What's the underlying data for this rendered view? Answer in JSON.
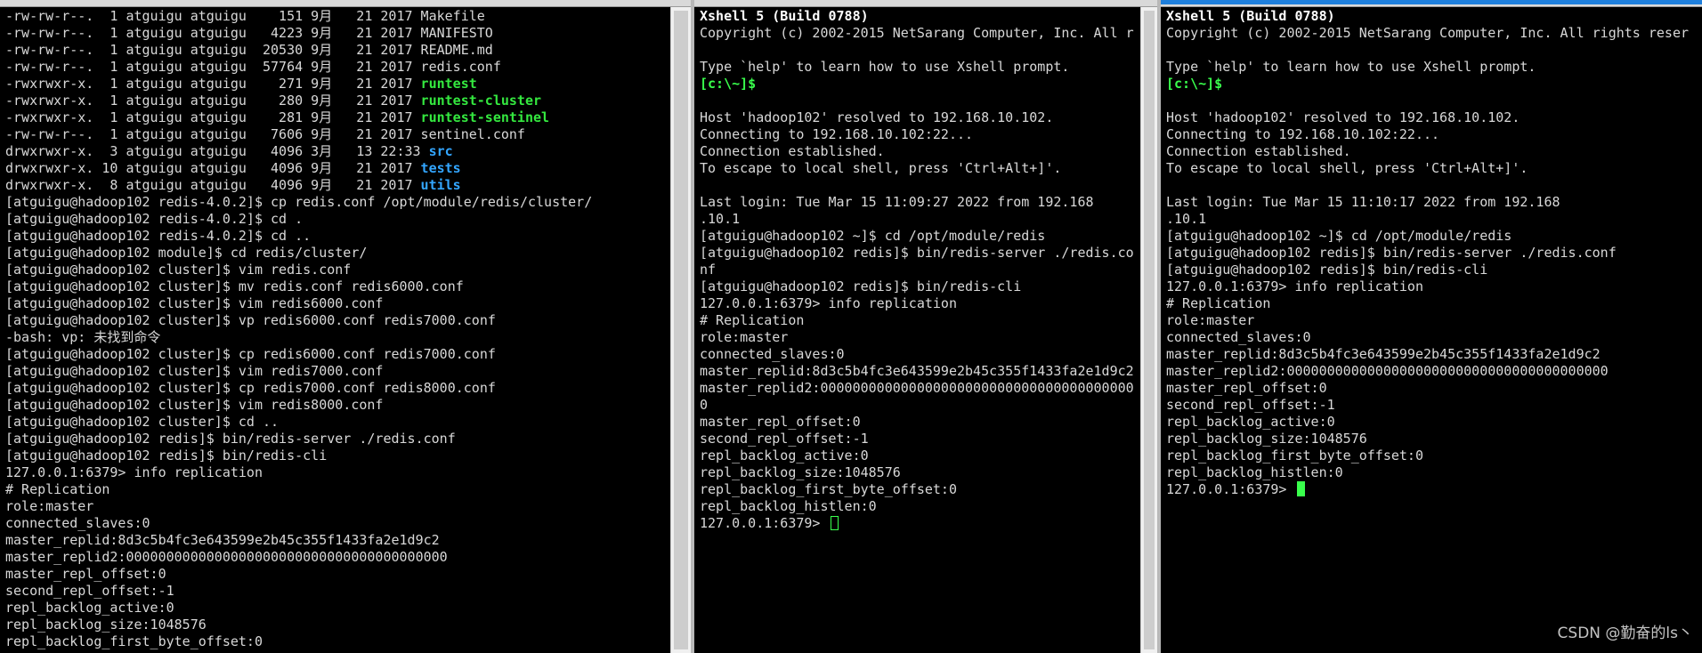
{
  "pane1": {
    "lines": [
      {
        "t": "-rw-rw-r--.  1 atguigu atguigu    151 9月   21 2017 Makefile"
      },
      {
        "t": "-rw-rw-r--.  1 atguigu atguigu   4223 9月   21 2017 MANIFESTO"
      },
      {
        "t": "-rw-rw-r--.  1 atguigu atguigu  20530 9月   21 2017 README.md"
      },
      {
        "t": "-rw-rw-r--.  1 atguigu atguigu  57764 9月   21 2017 redis.conf"
      },
      {
        "t": "-rwxrwxr-x.  1 atguigu atguigu    271 9月   21 2017 ",
        "hl": "runtest",
        "c": "exec"
      },
      {
        "t": "-rwxrwxr-x.  1 atguigu atguigu    280 9月   21 2017 ",
        "hl": "runtest-cluster",
        "c": "exec"
      },
      {
        "t": "-rwxrwxr-x.  1 atguigu atguigu    281 9月   21 2017 ",
        "hl": "runtest-sentinel",
        "c": "exec"
      },
      {
        "t": "-rw-rw-r--.  1 atguigu atguigu   7606 9月   21 2017 sentinel.conf"
      },
      {
        "t": "drwxrwxr-x.  3 atguigu atguigu   4096 3月   13 22:33 ",
        "hl": "src",
        "c": "dir"
      },
      {
        "t": "drwxrwxr-x. 10 atguigu atguigu   4096 9月   21 2017 ",
        "hl": "tests",
        "c": "dir"
      },
      {
        "t": "drwxrwxr-x.  8 atguigu atguigu   4096 9月   21 2017 ",
        "hl": "utils",
        "c": "dir"
      },
      {
        "t": "[atguigu@hadoop102 redis-4.0.2]$ cp redis.conf /opt/module/redis/cluster/"
      },
      {
        "t": "[atguigu@hadoop102 redis-4.0.2]$ cd ."
      },
      {
        "t": "[atguigu@hadoop102 redis-4.0.2]$ cd .."
      },
      {
        "t": "[atguigu@hadoop102 module]$ cd redis/cluster/"
      },
      {
        "t": "[atguigu@hadoop102 cluster]$ vim redis.conf"
      },
      {
        "t": "[atguigu@hadoop102 cluster]$ mv redis.conf redis6000.conf"
      },
      {
        "t": "[atguigu@hadoop102 cluster]$ vim redis6000.conf"
      },
      {
        "t": "[atguigu@hadoop102 cluster]$ vp redis6000.conf redis7000.conf"
      },
      {
        "t": "-bash: vp: 未找到命令"
      },
      {
        "t": "[atguigu@hadoop102 cluster]$ cp redis6000.conf redis7000.conf"
      },
      {
        "t": "[atguigu@hadoop102 cluster]$ vim redis7000.conf"
      },
      {
        "t": "[atguigu@hadoop102 cluster]$ cp redis7000.conf redis8000.conf"
      },
      {
        "t": "[atguigu@hadoop102 cluster]$ vim redis8000.conf"
      },
      {
        "t": "[atguigu@hadoop102 cluster]$ cd .."
      },
      {
        "t": "[atguigu@hadoop102 redis]$ bin/redis-server ./redis.conf"
      },
      {
        "t": "[atguigu@hadoop102 redis]$ bin/redis-cli"
      },
      {
        "t": "127.0.0.1:6379> info replication"
      },
      {
        "t": "# Replication"
      },
      {
        "t": "role:master"
      },
      {
        "t": "connected_slaves:0"
      },
      {
        "t": "master_replid:8d3c5b4fc3e643599e2b45c355f1433fa2e1d9c2"
      },
      {
        "t": "master_replid2:0000000000000000000000000000000000000000"
      },
      {
        "t": "master_repl_offset:0"
      },
      {
        "t": "second_repl_offset:-1"
      },
      {
        "t": "repl_backlog_active:0"
      },
      {
        "t": "repl_backlog_size:1048576"
      },
      {
        "t": "repl_backlog_first_byte_offset:0"
      }
    ]
  },
  "pane2": {
    "lines": [
      {
        "t": "Xshell 5 (Build 0788)",
        "c": "hdr"
      },
      {
        "t": "Copyright (c) 2002-2015 NetSarang Computer, Inc. All r"
      },
      {
        "t": ""
      },
      {
        "t": "Type `help' to learn how to use Xshell prompt."
      },
      {
        "t": "",
        "hl": "[c:\\~]$",
        "c": "prompt-green"
      },
      {
        "t": ""
      },
      {
        "t": "Host 'hadoop102' resolved to 192.168.10.102."
      },
      {
        "t": "Connecting to 192.168.10.102:22..."
      },
      {
        "t": "Connection established."
      },
      {
        "t": "To escape to local shell, press 'Ctrl+Alt+]'."
      },
      {
        "t": ""
      },
      {
        "t": "Last login: Tue Mar 15 11:09:27 2022 from 192.168"
      },
      {
        "t": ".10.1"
      },
      {
        "t": "[atguigu@hadoop102 ~]$ cd /opt/module/redis"
      },
      {
        "t": "[atguigu@hadoop102 redis]$ bin/redis-server ./redis.co"
      },
      {
        "t": "nf"
      },
      {
        "t": "[atguigu@hadoop102 redis]$ bin/redis-cli"
      },
      {
        "t": "127.0.0.1:6379> info replication"
      },
      {
        "t": "# Replication"
      },
      {
        "t": "role:master"
      },
      {
        "t": "connected_slaves:0"
      },
      {
        "t": "master_replid:8d3c5b4fc3e643599e2b45c355f1433fa2e1d9c2"
      },
      {
        "t": "master_replid2:000000000000000000000000000000000000000"
      },
      {
        "t": "0"
      },
      {
        "t": "master_repl_offset:0"
      },
      {
        "t": "second_repl_offset:-1"
      },
      {
        "t": "repl_backlog_active:0"
      },
      {
        "t": "repl_backlog_size:1048576"
      },
      {
        "t": "repl_backlog_first_byte_offset:0"
      },
      {
        "t": "repl_backlog_histlen:0"
      },
      {
        "t": "127.0.0.1:6379> ",
        "cursor": "box"
      }
    ]
  },
  "pane3": {
    "lines": [
      {
        "t": "Xshell 5 (Build 0788)",
        "c": "hdr"
      },
      {
        "t": "Copyright (c) 2002-2015 NetSarang Computer, Inc. All rights reser"
      },
      {
        "t": ""
      },
      {
        "t": "Type `help' to learn how to use Xshell prompt."
      },
      {
        "t": "",
        "hl": "[c:\\~]$",
        "c": "prompt-green"
      },
      {
        "t": ""
      },
      {
        "t": "Host 'hadoop102' resolved to 192.168.10.102."
      },
      {
        "t": "Connecting to 192.168.10.102:22..."
      },
      {
        "t": "Connection established."
      },
      {
        "t": "To escape to local shell, press 'Ctrl+Alt+]'."
      },
      {
        "t": ""
      },
      {
        "t": "Last login: Tue Mar 15 11:10:17 2022 from 192.168"
      },
      {
        "t": ".10.1"
      },
      {
        "t": "[atguigu@hadoop102 ~]$ cd /opt/module/redis"
      },
      {
        "t": "[atguigu@hadoop102 redis]$ bin/redis-server ./redis.conf"
      },
      {
        "t": "[atguigu@hadoop102 redis]$ bin/redis-cli"
      },
      {
        "t": "127.0.0.1:6379> info replication"
      },
      {
        "t": "# Replication"
      },
      {
        "t": "role:master"
      },
      {
        "t": "connected_slaves:0"
      },
      {
        "t": "master_replid:8d3c5b4fc3e643599e2b45c355f1433fa2e1d9c2"
      },
      {
        "t": "master_replid2:0000000000000000000000000000000000000000"
      },
      {
        "t": "master_repl_offset:0"
      },
      {
        "t": "second_repl_offset:-1"
      },
      {
        "t": "repl_backlog_active:0"
      },
      {
        "t": "repl_backlog_size:1048576"
      },
      {
        "t": "repl_backlog_first_byte_offset:0"
      },
      {
        "t": "repl_backlog_histlen:0"
      },
      {
        "t": "127.0.0.1:6379> ",
        "cursor": "fill"
      }
    ]
  },
  "watermark": "CSDN @勤奋的ls丶",
  "colors": {
    "background": "#000000",
    "text": "#d8d8d8",
    "executable": "#34e83f",
    "directory": "#33a6ff",
    "prompt": "#39ff4c",
    "active_accent": "#1e7fdc"
  }
}
